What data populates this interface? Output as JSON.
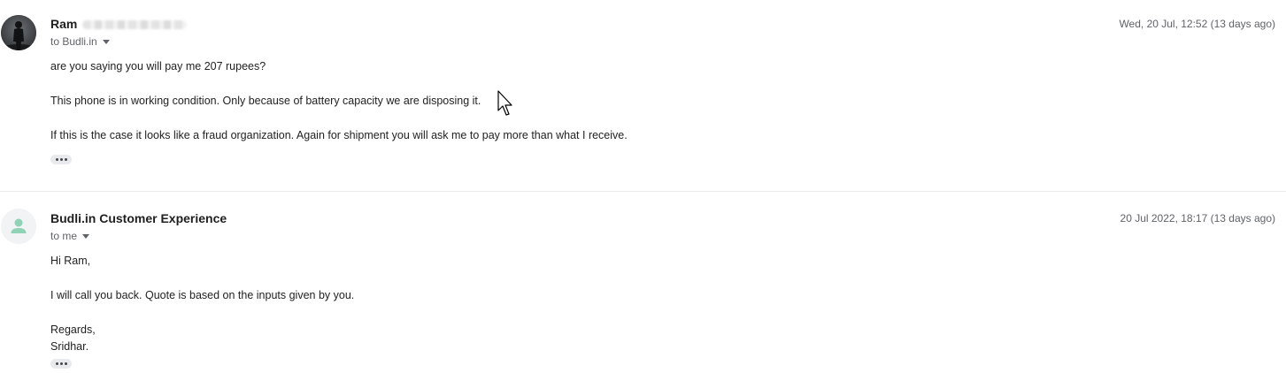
{
  "messages": [
    {
      "sender": "Ram",
      "recipient": "to Budli.in",
      "timestamp": "Wed, 20 Jul, 12:52 (13 days ago)",
      "body": [
        "are you saying you will pay me 207 rupees?",
        "This phone is in working condition. Only because of battery capacity we are disposing it.",
        "If this is the case it looks like a fraud organization. Again for shipment you will ask me to pay more than what I receive."
      ]
    },
    {
      "sender": "Budli.in Customer Experience",
      "recipient": "to me",
      "timestamp": "20 Jul 2022, 18:17 (13 days ago)",
      "body": [
        "Hi Ram,",
        "I will call you back. Quote is based on the inputs given by you.",
        "Regards,",
        "Sridhar."
      ]
    }
  ],
  "icons": {
    "sender1_avatar": "photo-avatar",
    "sender2_avatar": "person-icon",
    "recipient_caret": "caret-down-icon",
    "trimmed_content": "more-horiz-icon",
    "mouse_pointer": "cursor-arrow-icon"
  },
  "colors": {
    "default_avatar_person": "#8fd2b5",
    "default_avatar_bg": "#f1f3f4",
    "divider": "#e8eaed"
  }
}
